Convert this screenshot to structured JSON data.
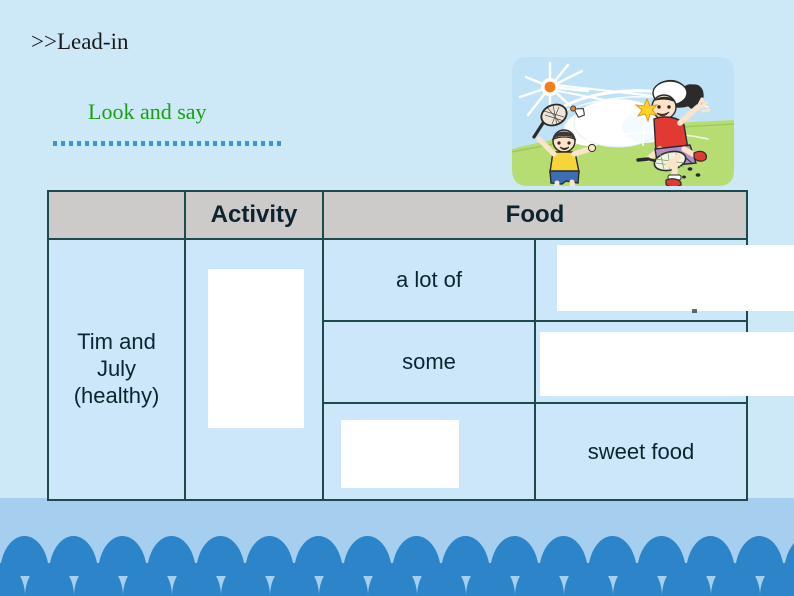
{
  "slide": {
    "section_marker": ">>Lead-in",
    "activity_prompt": "Look and say",
    "background_color": "#cde9f8",
    "band_color": "#a6cfef",
    "accent_green": "#18a011",
    "accent_blue": "#2b85c8",
    "border_color": "#1e4a4e",
    "header_fill": "#cdcbc9",
    "body_fill": "#cbe7f9"
  },
  "illustration": {
    "name": "children-playing-badminton",
    "description": "Two cartoon children playing badminton outdoors with sun, clouds and grass",
    "sky_color": "#bfe2f7",
    "grass_color": "#b8dc74",
    "sun_color": "#f08019",
    "boy_shirt_color": "#f5d53a",
    "boy_shorts_color": "#3a6fb5",
    "girl_shirt_color": "#e03a33",
    "girl_skirt_color": "#b08ec9",
    "shuttlecock_color": "#ffd32a"
  },
  "table": {
    "headers": [
      "",
      "Activity",
      "Food"
    ],
    "rows": [
      {
        "subject": "Tim and July (healthy)",
        "subject_lines": [
          "Tim and",
          "July",
          "(healthy)"
        ],
        "activity": "",
        "quantity": "a lot of",
        "food": ""
      },
      {
        "subject": "",
        "activity": "",
        "quantity": "some",
        "food": ""
      },
      {
        "subject": "",
        "activity": "",
        "quantity": "",
        "food": "sweet food"
      }
    ],
    "blanks": [
      {
        "name": "activity-blank",
        "cell": "row1-activity"
      },
      {
        "name": "food-blank-1",
        "cell": "row1-food"
      },
      {
        "name": "food-blank-2",
        "cell": "row2-food"
      },
      {
        "name": "quantity-blank-3",
        "cell": "row3-quantity"
      }
    ]
  },
  "decoration": {
    "arch_count_back": 17,
    "arch_count_front": 17
  }
}
